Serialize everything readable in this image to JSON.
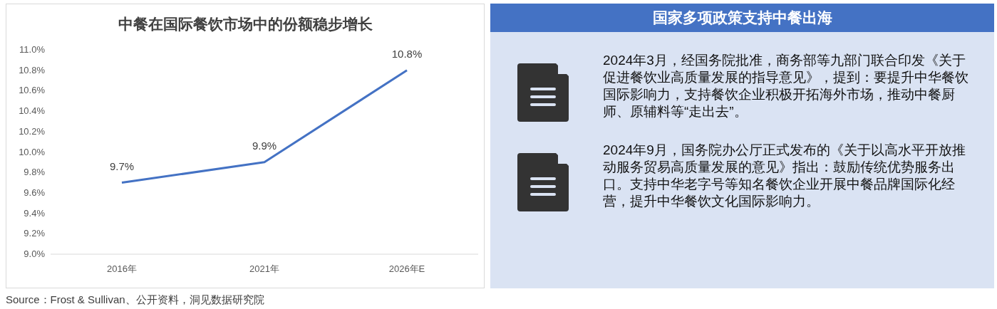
{
  "chart_panel": {
    "title": "中餐在国际餐饮市场中的份额稳步增长",
    "chart_data": {
      "type": "line",
      "categories": [
        "2016年",
        "2021年",
        "2026年E"
      ],
      "series": [
        {
          "color": "#4472c4",
          "values": [
            9.7,
            9.9,
            10.8
          ]
        }
      ],
      "ylim": [
        9.0,
        11.0
      ],
      "yticks": [
        {
          "value": 9.0,
          "label": "9.0%"
        },
        {
          "value": 9.2,
          "label": "9.2%"
        },
        {
          "value": 9.4,
          "label": "9.4%"
        },
        {
          "value": 9.6,
          "label": "9.6%"
        },
        {
          "value": 9.8,
          "label": "9.8%"
        },
        {
          "value": 10.0,
          "label": "10.0%"
        },
        {
          "value": 10.2,
          "label": "10.2%"
        },
        {
          "value": 10.4,
          "label": "10.4%"
        },
        {
          "value": 10.6,
          "label": "10.6%"
        },
        {
          "value": 10.8,
          "label": "10.8%"
        },
        {
          "value": 11.0,
          "label": "11.0%"
        }
      ],
      "value_labels": [
        "9.7%",
        "9.9%",
        "10.8%"
      ]
    }
  },
  "source": "Source：Frost & Sullivan、公开资料，洞见数据研究院",
  "policy_panel": {
    "title": "国家多项政策支持中餐出海",
    "items": [
      {
        "text": "2024年3月，经国务院批准，商务部等九部门联合印发《关于促进餐饮业高质量发展的指导意见》，提到：要提升中华餐饮国际影响力，支持餐饮企业积极开拓海外市场，推动中餐厨师、原辅料等“走出去”。"
      },
      {
        "text": "2024年9月，国务院办公厅正式发布的《关于以高水平开放推动服务贸易高质量发展的意见》指出：鼓励传统优势服务出口。支持中华老字号等知名餐饮企业开展中餐品牌国际化经营，提升中华餐饮文化国际影响力。"
      }
    ]
  }
}
